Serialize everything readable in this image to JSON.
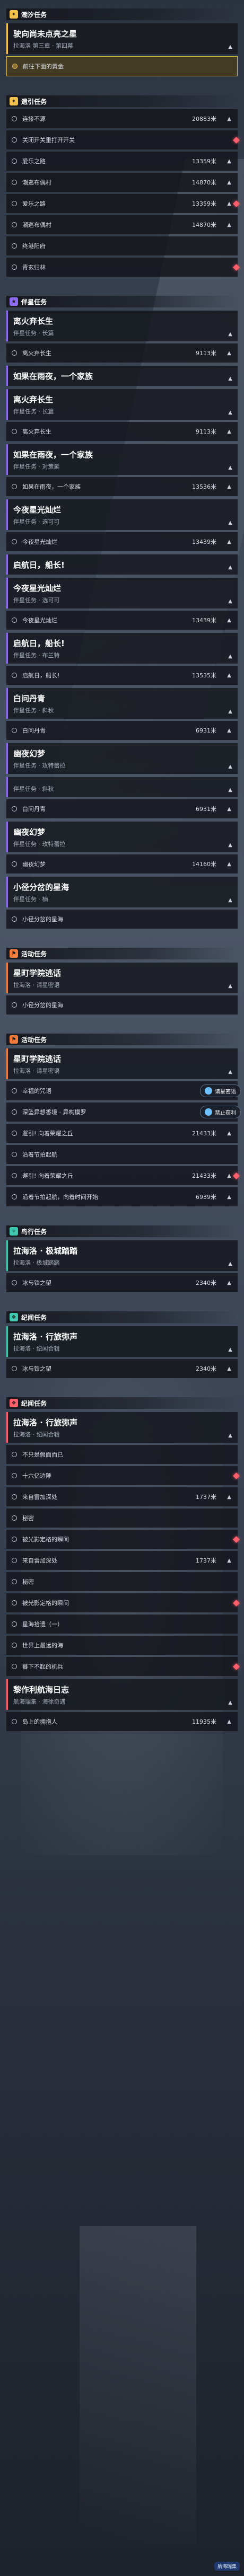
{
  "colors": {
    "main": "#f2c14e",
    "side": "#8e6cf2",
    "event": "#f07d3d",
    "daily": "#3fc7b0",
    "story": "#ff5e6b"
  },
  "sections": [
    {
      "header": "潮汐任务",
      "icon": "gear-icon",
      "color": "#f2c14e",
      "quests": [
        {
          "title": "驶向尚未点亮之星",
          "subtitle": "拉海洛 第三章 · 第四幕",
          "objectives": [
            {
              "label": "前往下面的黄金",
              "distance": "",
              "highlight": true
            }
          ]
        }
      ]
    },
    {
      "header": "遗引任务",
      "icon": "gear-icon",
      "color": "#f2c14e",
      "quests": [
        {
          "title": "",
          "subtitle": "",
          "objectives": [
            {
              "label": "连接不源",
              "distance": "20883米"
            },
            {
              "label": "关闭开关重打开开关",
              "distance": ""
            },
            {
              "label": "爱乐之路",
              "distance": "13359米"
            },
            {
              "label": "潮巡布偶村",
              "distance": "14870米"
            },
            {
              "label": "爱乐之路",
              "distance": "13359米"
            },
            {
              "label": "潮巡布偶村",
              "distance": "14870米"
            },
            {
              "label": "终港阳府",
              "distance": ""
            },
            {
              "label": "青玄归林",
              "distance": ""
            }
          ]
        }
      ]
    },
    {
      "header": "伴星任务",
      "icon": "star-icon",
      "color": "#8e6cf2",
      "quests": [
        {
          "title": "离火弃长生",
          "subtitle": "伴星任务 · 长篇",
          "objectives": [
            {
              "label": "离火弃长生",
              "distance": "9113米"
            }
          ]
        },
        {
          "title": "如果在雨夜，一个家族",
          "subtitle": "",
          "objectives": []
        },
        {
          "title": "离火弃长生",
          "subtitle": "伴星任务 · 长篇",
          "objectives": [
            {
              "label": "离火弃长生",
              "distance": "9113米"
            }
          ]
        },
        {
          "title": "如果在雨夜，一个家族",
          "subtitle": "伴星任务 · 对策延",
          "objectives": [
            {
              "label": "如果在雨夜，一个家族",
              "distance": "13536米"
            }
          ]
        },
        {
          "title": "今夜星光灿烂",
          "subtitle": "伴星任务 · 选可可",
          "objectives": [
            {
              "label": "今夜星光灿烂",
              "distance": "13439米"
            }
          ]
        },
        {
          "title": "启航日，船长!",
          "subtitle": "",
          "objectives": []
        },
        {
          "title": "今夜星光灿烂",
          "subtitle": "伴星任务 · 选可可",
          "objectives": [
            {
              "label": "今夜星光灿烂",
              "distance": "13439米"
            }
          ]
        },
        {
          "title": "启航日，船长!",
          "subtitle": "伴星任务 · 布兰特",
          "objectives": [
            {
              "label": "启航日，船长!",
              "distance": "13535米"
            }
          ]
        },
        {
          "title": "白问丹青",
          "subtitle": "伴星任务 · 斜秋",
          "objectives": [
            {
              "label": "白问丹青",
              "distance": "6931米"
            }
          ]
        },
        {
          "title": "幽夜幻梦",
          "subtitle": "伴星任务 · 玫特蕾拉",
          "objectives": []
        },
        {
          "title": "",
          "subtitle": "伴星任务 · 斜秋",
          "objectives": [
            {
              "label": "白问丹青",
              "distance": "6931米"
            }
          ]
        },
        {
          "title": "幽夜幻梦",
          "subtitle": "伴星任务 · 玫特蕾拉",
          "objectives": [
            {
              "label": "幽夜幻梦",
              "distance": "14160米"
            }
          ]
        },
        {
          "title": "小径分岔的星海",
          "subtitle": "伴星任务 · 楠",
          "objectives": [
            {
              "label": "小径分岔的星海",
              "distance": ""
            }
          ]
        }
      ]
    },
    {
      "header": "活动任务",
      "icon": "flag-icon",
      "color": "#f07d3d",
      "quests": [
        {
          "title": "星町学院逃话",
          "subtitle": "拉海洛 · 请星密语",
          "objectives": [
            {
              "label": "小径分岔的星海",
              "distance": ""
            }
          ]
        }
      ]
    },
    {
      "header": "活动任务",
      "icon": "flag-icon",
      "color": "#f07d3d",
      "quests": [
        {
          "title": "星町学院逃话",
          "subtitle": "拉海洛 · 请星密语",
          "objectives": [
            {
              "label": "幸福的咒语",
              "distance": "",
              "tag": "请星密语"
            },
            {
              "label": "深坠异想香境 · 异构模罗",
              "distance": "",
              "tag": "禁止获利"
            },
            {
              "label": "邂引! 向着荣耀之丘",
              "distance": "21433米"
            },
            {
              "label": "沿着节拍起航",
              "distance": ""
            },
            {
              "label": "邂引! 向着荣耀之丘",
              "distance": "21433米"
            },
            {
              "label": "沿着节拍起航，向着时间开始",
              "distance": "6939米"
            }
          ]
        }
      ]
    },
    {
      "header": "鸟行任务",
      "icon": "compass-icon",
      "color": "#3fc7b0",
      "quests": [
        {
          "title": "拉海洛 · 极城踏踏",
          "subtitle": "拉海洛 · 极城踏踏",
          "objectives": [
            {
              "label": "冰与铁之望",
              "distance": "2340米"
            }
          ]
        }
      ]
    },
    {
      "header": "纪闻任务",
      "icon": "book-icon",
      "color": "#3fc7b0",
      "quests": [
        {
          "title": "拉海洛 · 行旅弥声",
          "subtitle": "拉海洛 · 纪闻合辑",
          "objectives": [
            {
              "label": "冰与铁之望",
              "distance": "2340米"
            }
          ]
        }
      ]
    },
    {
      "header": "纪闻任务",
      "icon": "book-icon",
      "color": "#ff5e6b",
      "quests": [
        {
          "title": "拉海洛 · 行旅弥声",
          "subtitle": "拉海洛 · 纪闻合辑",
          "objectives": [
            {
              "label": "不只是假面而已",
              "distance": ""
            },
            {
              "label": "十六亿边陲",
              "distance": ""
            },
            {
              "label": "来自雷加深处",
              "distance": "1737米"
            },
            {
              "label": "秘密",
              "distance": ""
            },
            {
              "label": "被光影定格的瞬间",
              "distance": ""
            },
            {
              "label": "来自雷加深处",
              "distance": "1737米"
            },
            {
              "label": "秘密",
              "distance": ""
            },
            {
              "label": "被光影定格的瞬间",
              "distance": ""
            },
            {
              "label": "星海拾遗（一）",
              "distance": ""
            },
            {
              "label": "世界上最远的海",
              "distance": ""
            },
            {
              "label": "暮下不起的机兵",
              "distance": ""
            }
          ]
        },
        {
          "title": "黎作利航海日志",
          "subtitle": "航海瑞集 · 海徐奇遇",
          "objectives": [
            {
              "label": "岛上的拥抱人",
              "distance": "11935米"
            }
          ]
        }
      ]
    }
  ],
  "page_badge": "航海瑞集"
}
